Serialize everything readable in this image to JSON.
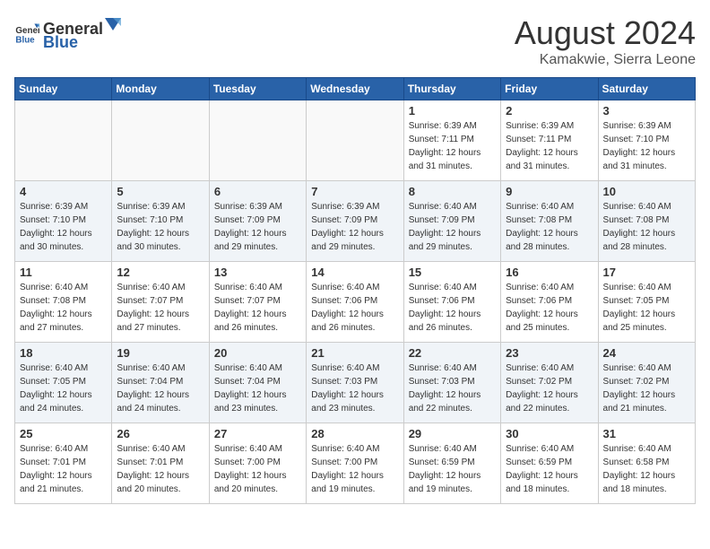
{
  "header": {
    "logo_general": "General",
    "logo_blue": "Blue",
    "month_year": "August 2024",
    "location": "Kamakwie, Sierra Leone"
  },
  "days_of_week": [
    "Sunday",
    "Monday",
    "Tuesday",
    "Wednesday",
    "Thursday",
    "Friday",
    "Saturday"
  ],
  "weeks": [
    [
      {
        "day": "",
        "info": ""
      },
      {
        "day": "",
        "info": ""
      },
      {
        "day": "",
        "info": ""
      },
      {
        "day": "",
        "info": ""
      },
      {
        "day": "1",
        "info": "Sunrise: 6:39 AM\nSunset: 7:11 PM\nDaylight: 12 hours\nand 31 minutes."
      },
      {
        "day": "2",
        "info": "Sunrise: 6:39 AM\nSunset: 7:11 PM\nDaylight: 12 hours\nand 31 minutes."
      },
      {
        "day": "3",
        "info": "Sunrise: 6:39 AM\nSunset: 7:10 PM\nDaylight: 12 hours\nand 31 minutes."
      }
    ],
    [
      {
        "day": "4",
        "info": "Sunrise: 6:39 AM\nSunset: 7:10 PM\nDaylight: 12 hours\nand 30 minutes."
      },
      {
        "day": "5",
        "info": "Sunrise: 6:39 AM\nSunset: 7:10 PM\nDaylight: 12 hours\nand 30 minutes."
      },
      {
        "day": "6",
        "info": "Sunrise: 6:39 AM\nSunset: 7:09 PM\nDaylight: 12 hours\nand 29 minutes."
      },
      {
        "day": "7",
        "info": "Sunrise: 6:39 AM\nSunset: 7:09 PM\nDaylight: 12 hours\nand 29 minutes."
      },
      {
        "day": "8",
        "info": "Sunrise: 6:40 AM\nSunset: 7:09 PM\nDaylight: 12 hours\nand 29 minutes."
      },
      {
        "day": "9",
        "info": "Sunrise: 6:40 AM\nSunset: 7:08 PM\nDaylight: 12 hours\nand 28 minutes."
      },
      {
        "day": "10",
        "info": "Sunrise: 6:40 AM\nSunset: 7:08 PM\nDaylight: 12 hours\nand 28 minutes."
      }
    ],
    [
      {
        "day": "11",
        "info": "Sunrise: 6:40 AM\nSunset: 7:08 PM\nDaylight: 12 hours\nand 27 minutes."
      },
      {
        "day": "12",
        "info": "Sunrise: 6:40 AM\nSunset: 7:07 PM\nDaylight: 12 hours\nand 27 minutes."
      },
      {
        "day": "13",
        "info": "Sunrise: 6:40 AM\nSunset: 7:07 PM\nDaylight: 12 hours\nand 26 minutes."
      },
      {
        "day": "14",
        "info": "Sunrise: 6:40 AM\nSunset: 7:06 PM\nDaylight: 12 hours\nand 26 minutes."
      },
      {
        "day": "15",
        "info": "Sunrise: 6:40 AM\nSunset: 7:06 PM\nDaylight: 12 hours\nand 26 minutes."
      },
      {
        "day": "16",
        "info": "Sunrise: 6:40 AM\nSunset: 7:06 PM\nDaylight: 12 hours\nand 25 minutes."
      },
      {
        "day": "17",
        "info": "Sunrise: 6:40 AM\nSunset: 7:05 PM\nDaylight: 12 hours\nand 25 minutes."
      }
    ],
    [
      {
        "day": "18",
        "info": "Sunrise: 6:40 AM\nSunset: 7:05 PM\nDaylight: 12 hours\nand 24 minutes."
      },
      {
        "day": "19",
        "info": "Sunrise: 6:40 AM\nSunset: 7:04 PM\nDaylight: 12 hours\nand 24 minutes."
      },
      {
        "day": "20",
        "info": "Sunrise: 6:40 AM\nSunset: 7:04 PM\nDaylight: 12 hours\nand 23 minutes."
      },
      {
        "day": "21",
        "info": "Sunrise: 6:40 AM\nSunset: 7:03 PM\nDaylight: 12 hours\nand 23 minutes."
      },
      {
        "day": "22",
        "info": "Sunrise: 6:40 AM\nSunset: 7:03 PM\nDaylight: 12 hours\nand 22 minutes."
      },
      {
        "day": "23",
        "info": "Sunrise: 6:40 AM\nSunset: 7:02 PM\nDaylight: 12 hours\nand 22 minutes."
      },
      {
        "day": "24",
        "info": "Sunrise: 6:40 AM\nSunset: 7:02 PM\nDaylight: 12 hours\nand 21 minutes."
      }
    ],
    [
      {
        "day": "25",
        "info": "Sunrise: 6:40 AM\nSunset: 7:01 PM\nDaylight: 12 hours\nand 21 minutes."
      },
      {
        "day": "26",
        "info": "Sunrise: 6:40 AM\nSunset: 7:01 PM\nDaylight: 12 hours\nand 20 minutes."
      },
      {
        "day": "27",
        "info": "Sunrise: 6:40 AM\nSunset: 7:00 PM\nDaylight: 12 hours\nand 20 minutes."
      },
      {
        "day": "28",
        "info": "Sunrise: 6:40 AM\nSunset: 7:00 PM\nDaylight: 12 hours\nand 19 minutes."
      },
      {
        "day": "29",
        "info": "Sunrise: 6:40 AM\nSunset: 6:59 PM\nDaylight: 12 hours\nand 19 minutes."
      },
      {
        "day": "30",
        "info": "Sunrise: 6:40 AM\nSunset: 6:59 PM\nDaylight: 12 hours\nand 18 minutes."
      },
      {
        "day": "31",
        "info": "Sunrise: 6:40 AM\nSunset: 6:58 PM\nDaylight: 12 hours\nand 18 minutes."
      }
    ]
  ]
}
